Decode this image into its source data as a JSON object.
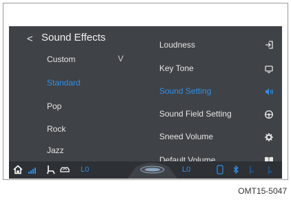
{
  "header": {
    "back_label": "<",
    "title": "Sound Effects"
  },
  "presets": {
    "selected_chevron": "V",
    "items": [
      {
        "label": "Custom"
      },
      {
        "label": "Standard"
      },
      {
        "label": "Pop"
      },
      {
        "label": "Rock"
      },
      {
        "label": "Jazz"
      }
    ]
  },
  "settings": {
    "items": [
      {
        "label": "Loudness",
        "icon": "sign-in-icon"
      },
      {
        "label": "Key Tone",
        "icon": "monitor-icon"
      },
      {
        "label": "Sound Setting",
        "icon": "speaker-icon"
      },
      {
        "label": "Sound Field Setting",
        "icon": "steering-wheel-icon"
      },
      {
        "label": "Sneed Volume",
        "icon": "gear-icon"
      },
      {
        "label": "Default Volume",
        "icon": "book-icon"
      }
    ]
  },
  "bottom_bar": {
    "left_temp": "L0",
    "right_temp": "L0"
  },
  "colors": {
    "accent": "#2f8fe6",
    "screen_bg": "#3f4246",
    "bar_bg": "#2d3035"
  },
  "caption": "OMT15-5047"
}
